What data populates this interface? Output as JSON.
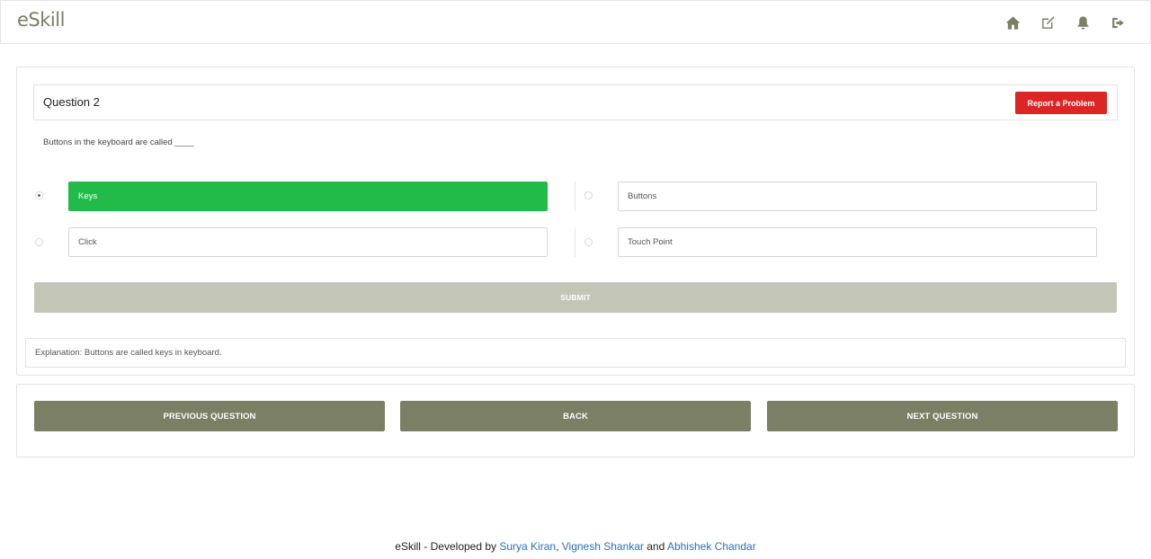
{
  "navbar": {
    "brand": "eSkill",
    "icons": [
      "home-icon",
      "edit-icon",
      "bell-icon",
      "sign-out-icon"
    ]
  },
  "question": {
    "title": "Question 2",
    "report_label": "Report a Problem",
    "text": "Buttons in the keyboard are called ____",
    "options": [
      {
        "label": "Keys",
        "selected": true
      },
      {
        "label": "Buttons",
        "selected": false
      },
      {
        "label": "Click",
        "selected": false
      },
      {
        "label": "Touch Point",
        "selected": false
      }
    ],
    "submit_label": "SUBMIT",
    "explanation": "Explanation: Buttons are called keys in keyboard."
  },
  "navigation": {
    "previous_label": "PREVIOUS QUESTION",
    "back_label": "BACK",
    "next_label": "NEXT QUESTION"
  },
  "footer": {
    "prefix": "eSkill - Developed by ",
    "dev1": "Surya Kiran",
    "sep1": ", ",
    "dev2": "Vignesh Shankar",
    "sep2": " and ",
    "dev3": "Abhishek Chandar"
  },
  "colors": {
    "brand": "#7b7f63",
    "selected_option": "#22bb4a",
    "report_button": "#dc2626",
    "submit_disabled": "#c3c6b7",
    "link": "#2d6fb8"
  }
}
